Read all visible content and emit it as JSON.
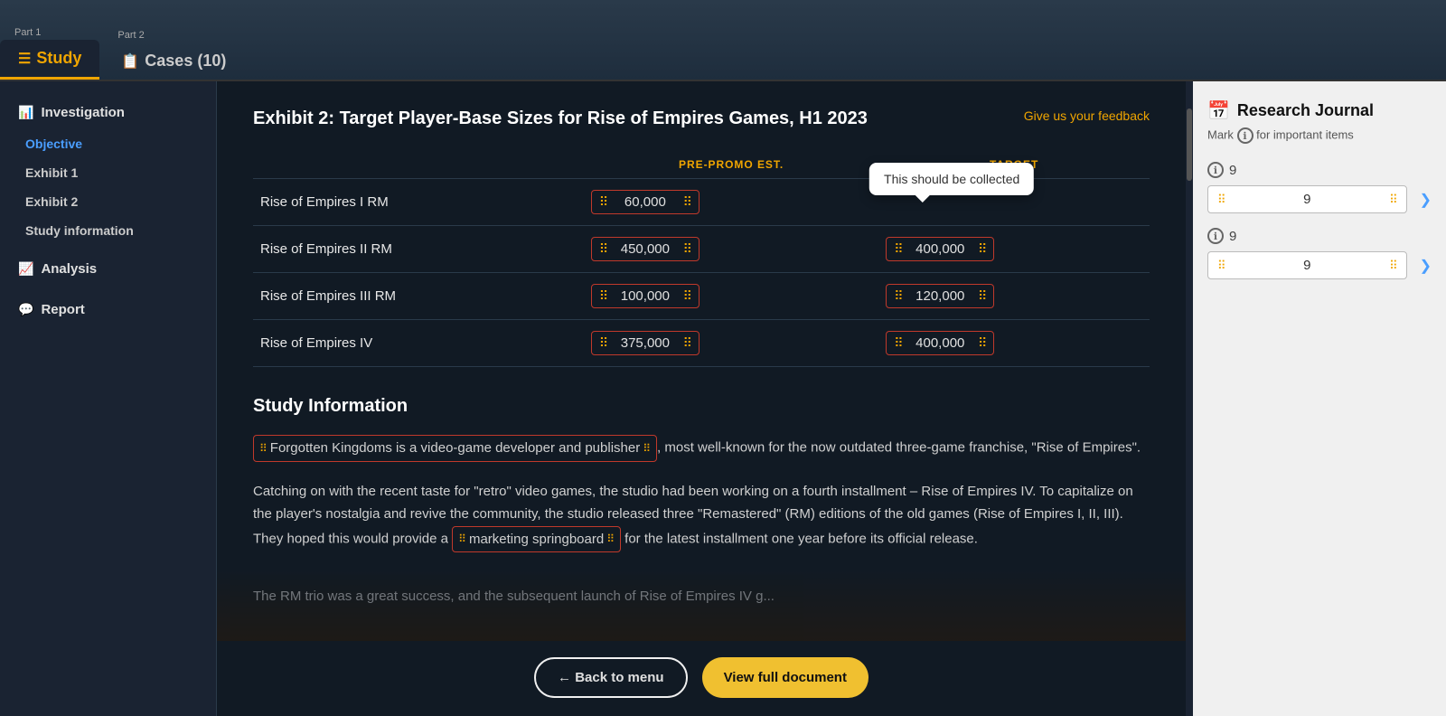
{
  "topbar": {
    "part1_label": "Part 1",
    "part2_label": "Part 2",
    "tab1_label": "Study",
    "tab2_label": "Cases (10)"
  },
  "sidebar": {
    "investigation_label": "Investigation",
    "objective_label": "Objective",
    "exhibit1_label": "Exhibit 1",
    "exhibit2_label": "Exhibit 2",
    "study_info_label": "Study information",
    "analysis_label": "Analysis",
    "report_label": "Report"
  },
  "exhibit": {
    "title": "Exhibit 2: Target Player-Base Sizes for Rise of Empires Games, H1 2023",
    "feedback_label": "Give us your feedback",
    "col1": "PRE-PROMO EST.",
    "col2": "TARGET",
    "rows": [
      {
        "name": "Rise of Empires I RM",
        "pre": "60,000",
        "target": null
      },
      {
        "name": "Rise of Empires II RM",
        "pre": "450,000",
        "target": "400,000"
      },
      {
        "name": "Rise of Empires III RM",
        "pre": "100,000",
        "target": "120,000"
      },
      {
        "name": "Rise of Empires IV",
        "pre": "375,000",
        "target": "400,000"
      }
    ],
    "tooltip": "This should be collected"
  },
  "study_info": {
    "title": "Study Information",
    "para1_before": "",
    "highlight1": "Forgotten Kingdoms is a video-game developer and publisher",
    "para1_after": ", most well-known for the now outdated three-game franchise, \"Rise of Empires\".",
    "para2": "Catching on with the recent taste for \"retro\" video games, the studio had been working on a fourth installment – Rise of Empires IV. To capitalize on the player's nostalgia and revive the community, the studio released three \"Remastered\" (RM) editions of the old games (Rise of Empires I, II, III). They hoped this would provide a",
    "highlight2": "marketing springboard",
    "para2_after": "for the latest installment one year before its official release.",
    "para3_partial": "The RM trio was a great success, and the subsequent launch of Rise of Empires IV g..."
  },
  "buttons": {
    "back_label": "← Back to menu",
    "view_label": "View full document"
  },
  "journal": {
    "title": "Research Journal",
    "subtitle": "Mark",
    "subtitle2": "for important items",
    "item1_num": "9",
    "item1_val": "9",
    "item2_num": "9",
    "item2_val": "9"
  }
}
